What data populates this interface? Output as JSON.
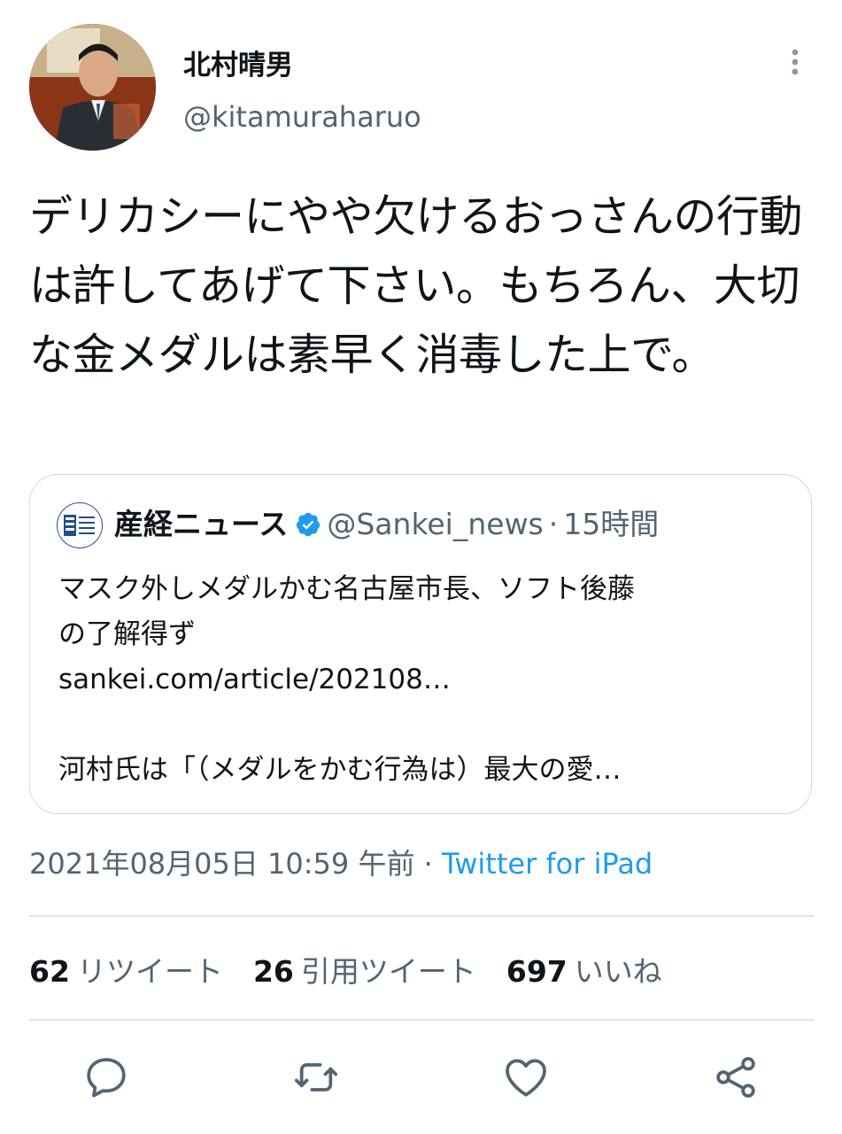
{
  "author": {
    "name": "北村晴男",
    "handle": "@kitamuraharuo"
  },
  "tweet": {
    "text": "デリカシーにやや欠けるおっさんの行動は許してあげて下さい。もちろん、大切な金メダルは素早く消毒した上で。"
  },
  "quoted": {
    "name": "産経ニュース",
    "handle": "@Sankei_news",
    "separator": "·",
    "time": "15時間",
    "lines": [
      "マスク外しメダルかむ名古屋市長、ソフト後藤",
      "の了解得ず",
      "sankei.com/article/202108…",
      "",
      "河村氏は「（メダルをかむ行為は）最大の愛…"
    ]
  },
  "meta": {
    "timestamp": "2021年08月05日 10:59 午前",
    "separator": " · ",
    "source": "Twitter for iPad"
  },
  "stats": [
    {
      "count": "62",
      "label": "リツイート"
    },
    {
      "count": "26",
      "label": "引用ツイート"
    },
    {
      "count": "697",
      "label": "いいね"
    }
  ],
  "icons": [
    "more-vertical-icon",
    "verified-icon",
    "reply-icon",
    "retweet-icon",
    "like-icon",
    "share-icon"
  ],
  "colors": {
    "accent": "#1d9bf0",
    "secondary_text": "#536471",
    "border": "#cfd9de",
    "verified": "#1d9bf0"
  }
}
